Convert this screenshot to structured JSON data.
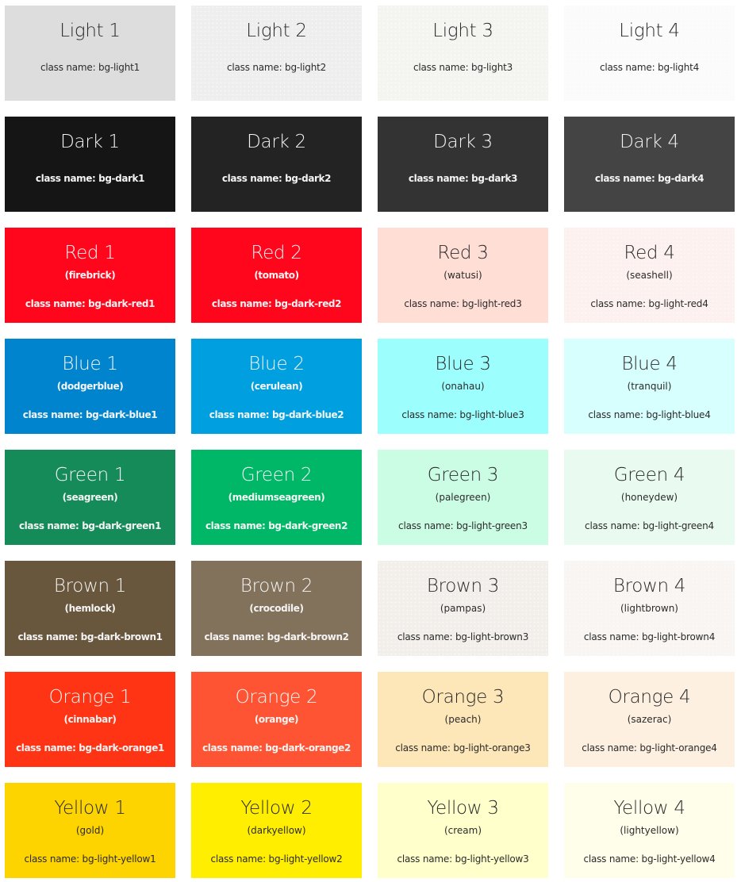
{
  "swatches": [
    {
      "title": "Light 1",
      "subtitle": "",
      "class_label": "class name: bg-light1",
      "color": "#dddddd",
      "tone": "light",
      "textured": false
    },
    {
      "title": "Light 2",
      "subtitle": "",
      "class_label": "class name: bg-light2",
      "color": "#eeeeee",
      "tone": "light",
      "textured": true
    },
    {
      "title": "Light 3",
      "subtitle": "",
      "class_label": "class name: bg-light3",
      "color": "#f4f4f1",
      "tone": "light",
      "textured": true
    },
    {
      "title": "Light 4",
      "subtitle": "",
      "class_label": "class name: bg-light4",
      "color": "#fbfbfb",
      "tone": "light",
      "textured": true
    },
    {
      "title": "Dark 1",
      "subtitle": "",
      "class_label": "class name: bg-dark1",
      "color": "#151515",
      "tone": "dark",
      "textured": false
    },
    {
      "title": "Dark 2",
      "subtitle": "",
      "class_label": "class name: bg-dark2",
      "color": "#232323",
      "tone": "dark",
      "textured": false
    },
    {
      "title": "Dark 3",
      "subtitle": "",
      "class_label": "class name: bg-dark3",
      "color": "#333333",
      "tone": "dark",
      "textured": false
    },
    {
      "title": "Dark 4",
      "subtitle": "",
      "class_label": "class name: bg-dark4",
      "color": "#444444",
      "tone": "dark",
      "textured": false
    },
    {
      "title": "Red 1",
      "subtitle": "(firebrick)",
      "class_label": "class name: bg-dark-red1",
      "color": "#ff061c",
      "tone": "dark",
      "textured": false
    },
    {
      "title": "Red 2",
      "subtitle": "(tomato)",
      "class_label": "class name: bg-dark-red2",
      "color": "#ff061c",
      "tone": "dark",
      "textured": false
    },
    {
      "title": "Red 3",
      "subtitle": "(watusi)",
      "class_label": "class name: bg-light-red3",
      "color": "#ffded6",
      "tone": "light",
      "textured": false
    },
    {
      "title": "Red 4",
      "subtitle": "(seashell)",
      "class_label": "class name: bg-light-red4",
      "color": "#fcf1ee",
      "tone": "light",
      "textured": true
    },
    {
      "title": "Blue 1",
      "subtitle": "(dodgerblue)",
      "class_label": "class name: bg-dark-blue1",
      "color": "#0084ce",
      "tone": "dark",
      "textured": false
    },
    {
      "title": "Blue 2",
      "subtitle": "(cerulean)",
      "class_label": "class name: bg-dark-blue2",
      "color": "#00a0e0",
      "tone": "dark",
      "textured": false
    },
    {
      "title": "Blue 3",
      "subtitle": "(onahau)",
      "class_label": "class name: bg-light-blue3",
      "color": "#9cfffe",
      "tone": "light",
      "textured": false
    },
    {
      "title": "Blue 4",
      "subtitle": "(tranquil)",
      "class_label": "class name: bg-light-blue4",
      "color": "#d6fffe",
      "tone": "light",
      "textured": false
    },
    {
      "title": "Green 1",
      "subtitle": "(seagreen)",
      "class_label": "class name: bg-dark-green1",
      "color": "#168b5a",
      "tone": "dark",
      "textured": false
    },
    {
      "title": "Green 2",
      "subtitle": "(mediumseagreen)",
      "class_label": "class name: bg-dark-green2",
      "color": "#00b767",
      "tone": "dark",
      "textured": false
    },
    {
      "title": "Green 3",
      "subtitle": "(palegreen)",
      "class_label": "class name: bg-light-green3",
      "color": "#cbfde5",
      "tone": "light",
      "textured": false
    },
    {
      "title": "Green 4",
      "subtitle": "(honeydew)",
      "class_label": "class name: bg-light-green4",
      "color": "#e9fbf0",
      "tone": "light",
      "textured": false
    },
    {
      "title": "Brown 1",
      "subtitle": "(hemlock)",
      "class_label": "class name: bg-dark-brown1",
      "color": "#68563d",
      "tone": "dark",
      "textured": false
    },
    {
      "title": "Brown 2",
      "subtitle": "(crocodile)",
      "class_label": "class name: bg-dark-brown2",
      "color": "#83725b",
      "tone": "dark",
      "textured": false
    },
    {
      "title": "Brown 3",
      "subtitle": "(pampas)",
      "class_label": "class name: bg-light-brown3",
      "color": "#f2efeb",
      "tone": "light",
      "textured": true
    },
    {
      "title": "Brown 4",
      "subtitle": "(lightbrown)",
      "class_label": "class name: bg-light-brown4",
      "color": "#f8f5f2",
      "tone": "light",
      "textured": true
    },
    {
      "title": "Orange 1",
      "subtitle": "(cinnabar)",
      "class_label": "class name: bg-dark-orange1",
      "color": "#ff3414",
      "tone": "dark",
      "textured": false
    },
    {
      "title": "Orange 2",
      "subtitle": "(orange)",
      "class_label": "class name: bg-dark-orange2",
      "color": "#ff5433",
      "tone": "dark",
      "textured": false
    },
    {
      "title": "Orange 3",
      "subtitle": "(peach)",
      "class_label": "class name: bg-light-orange3",
      "color": "#fde6b7",
      "tone": "light",
      "textured": false
    },
    {
      "title": "Orange 4",
      "subtitle": "(sazerac)",
      "class_label": "class name: bg-light-orange4",
      "color": "#fdf0e0",
      "tone": "light",
      "textured": false
    },
    {
      "title": "Yellow 1",
      "subtitle": "(gold)",
      "class_label": "class name: bg-light-yellow1",
      "color": "#fdd300",
      "tone": "light",
      "textured": false
    },
    {
      "title": "Yellow 2",
      "subtitle": "(darkyellow)",
      "class_label": "class name: bg-light-yellow2",
      "color": "#ffee00",
      "tone": "light",
      "textured": false
    },
    {
      "title": "Yellow 3",
      "subtitle": "(cream)",
      "class_label": "class name: bg-light-yellow3",
      "color": "#ffffcc",
      "tone": "light",
      "textured": false
    },
    {
      "title": "Yellow 4",
      "subtitle": "(lightyellow)",
      "class_label": "class name: bg-light-yellow4",
      "color": "#fffeea",
      "tone": "light",
      "textured": false
    }
  ]
}
